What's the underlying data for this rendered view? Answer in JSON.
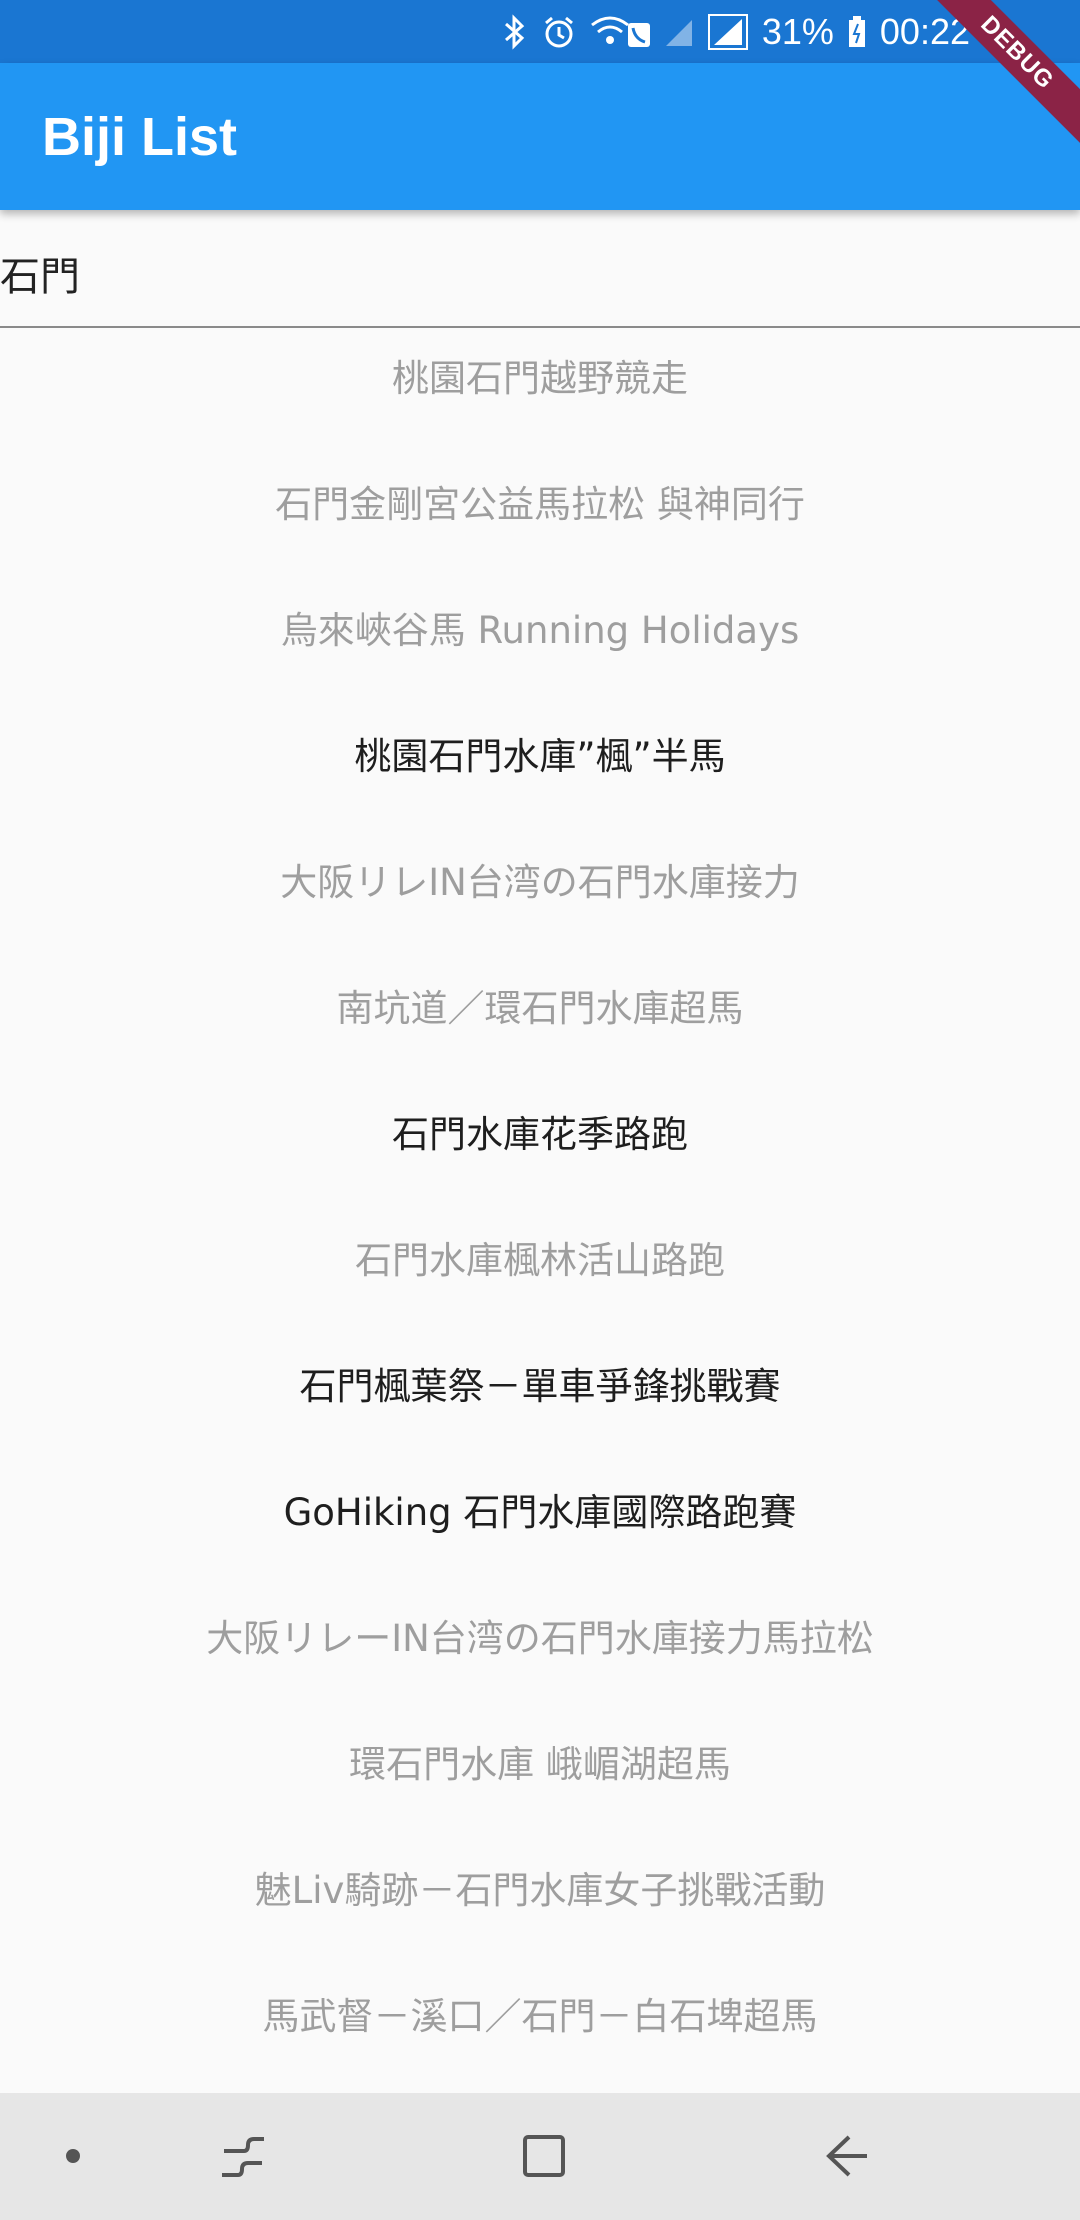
{
  "status_bar": {
    "battery": "31%",
    "time": "00:22",
    "icons": [
      "bluetooth-icon",
      "alarm-icon",
      "wifi-call-icon",
      "signal-icon",
      "signal-icon",
      "battery-icon"
    ]
  },
  "debug_banner": {
    "label": "DEBUG"
  },
  "app_bar": {
    "title": "Biji List"
  },
  "search": {
    "value": "石門"
  },
  "colors": {
    "status_bar": "#1a76d2",
    "app_bar": "#2196f3",
    "background": "#fafafa",
    "inactive_text": "#9e9e9e",
    "active_text": "#1e1e1e",
    "debug_ribbon": "#8b2346",
    "nav_bar": "#e6e6e6"
  },
  "results": [
    {
      "label": "桃園石門越野競走",
      "active": false
    },
    {
      "label": "石門金剛宮公益馬拉松 與神同行",
      "active": false
    },
    {
      "label": "烏來峽谷馬 Running Holidays",
      "active": false
    },
    {
      "label": "桃園石門水庫”楓”半馬",
      "active": true
    },
    {
      "label": "大阪リレIN台湾の石門水庫接力",
      "active": false
    },
    {
      "label": "南坑道／環石門水庫超馬",
      "active": false
    },
    {
      "label": "石門水庫花季路跑",
      "active": true
    },
    {
      "label": "石門水庫楓林活山路跑",
      "active": false
    },
    {
      "label": "石門楓葉祭－單車爭鋒挑戰賽",
      "active": true
    },
    {
      "label": "GoHiking 石門水庫國際路跑賽",
      "active": true
    },
    {
      "label": "大阪リレーIN台湾の石門水庫接力馬拉松",
      "active": false
    },
    {
      "label": "環石門水庫 峨嵋湖超馬",
      "active": false
    },
    {
      "label": "魅Liv騎跡－石門水庫女子挑戰活動",
      "active": false
    },
    {
      "label": "馬武督－溪口／石門－白石埤超馬",
      "active": false
    }
  ],
  "nav_bar": {
    "buttons": [
      "dot-icon",
      "recent-apps-icon",
      "home-icon",
      "back-icon"
    ]
  }
}
